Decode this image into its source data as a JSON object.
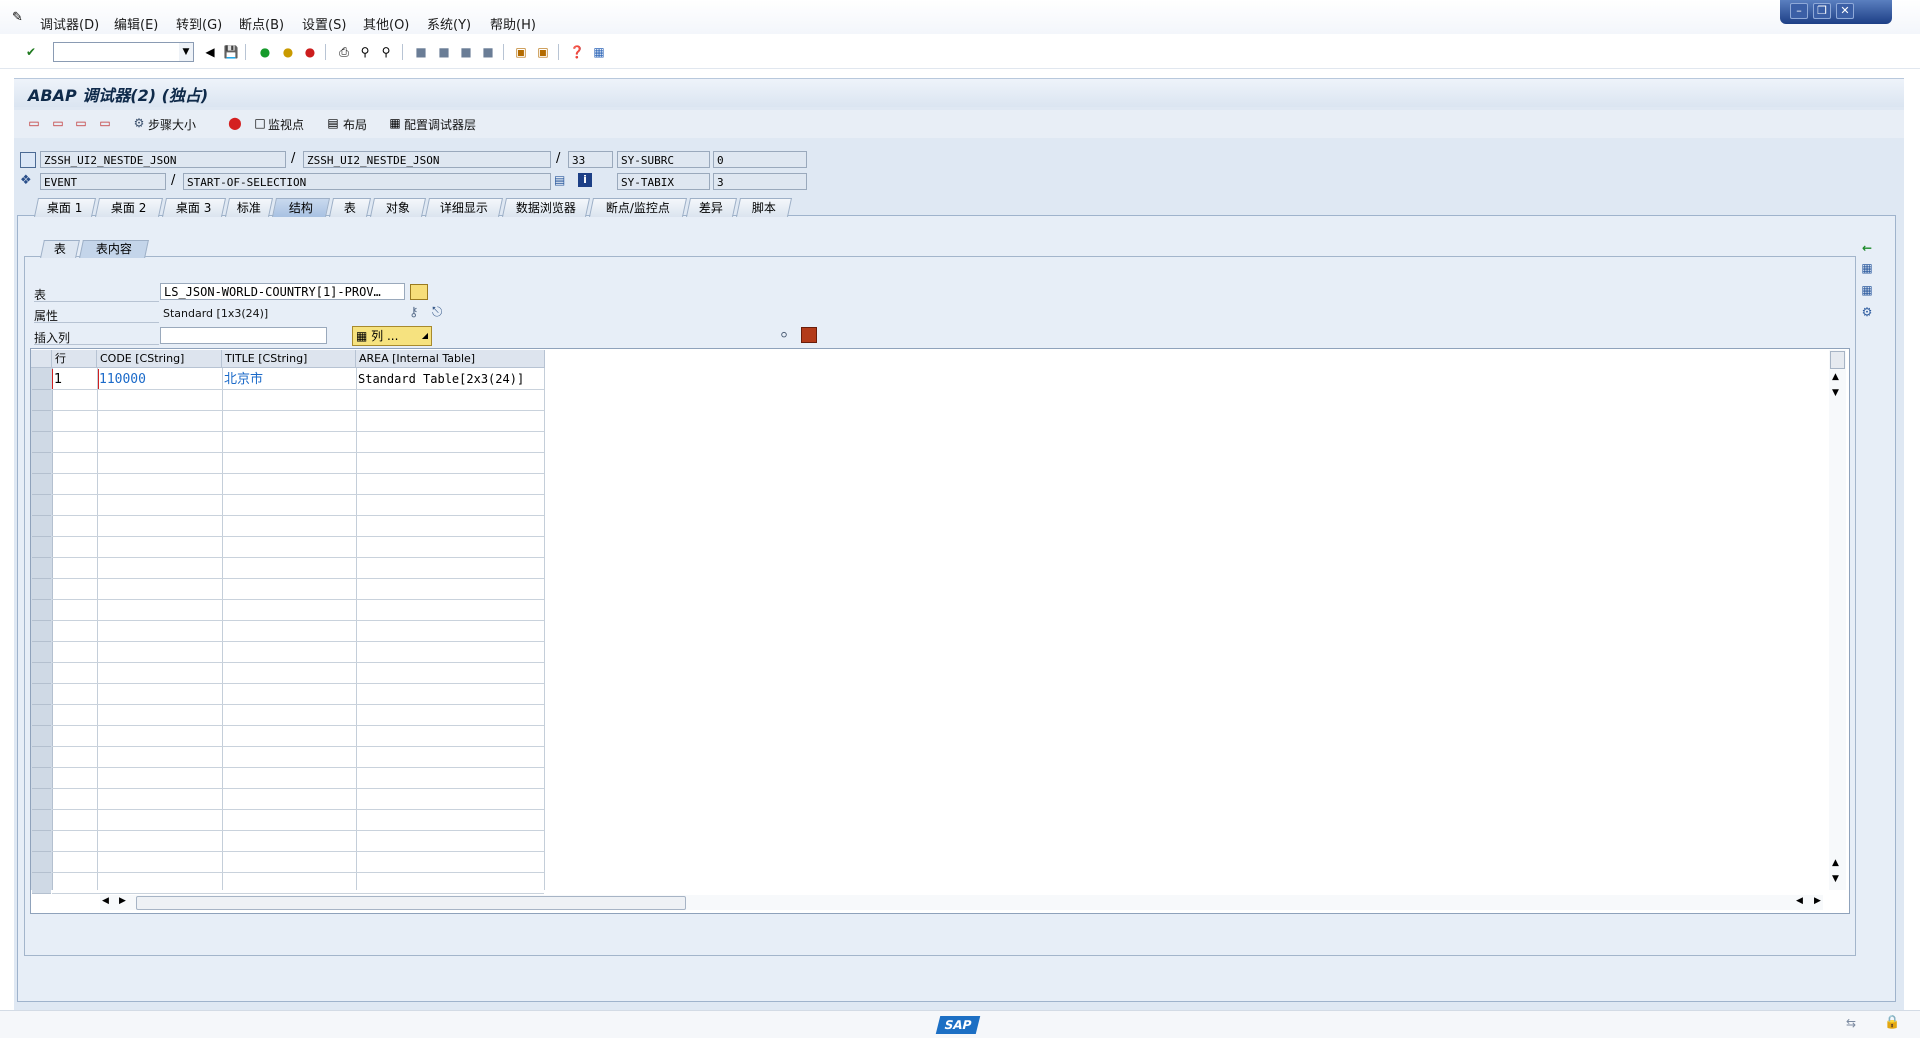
{
  "menu": [
    "调试器(D)",
    "编辑(E)",
    "转到(G)",
    "断点(B)",
    "设置(S)",
    "其他(O)",
    "系统(Y)",
    "帮助(H)"
  ],
  "title": "ABAP 调试器(2) (独占)",
  "app_toolbar": {
    "step_size": "步骤大小",
    "watchpoint": "监视点",
    "layout": "布局",
    "config_layer": "配置调试器层"
  },
  "info": {
    "program1": "ZSSH_UI2_NESTDE_JSON",
    "program2": "ZSSH_UI2_NESTDE_JSON",
    "line": "33",
    "event_type": "EVENT",
    "event_name": "START-OF-SELECTION",
    "sy1_name": "SY-SUBRC",
    "sy1_value": "0",
    "sy2_name": "SY-TABIX",
    "sy2_value": "3",
    "slash": "/"
  },
  "tabs": [
    "桌面 1",
    "桌面 2",
    "桌面 3",
    "标准",
    "结构",
    "表",
    "对象",
    "详细显示",
    "数据浏览器",
    "断点/监控点",
    "差异",
    "脚本"
  ],
  "subtabs": [
    "表",
    "表内容"
  ],
  "table_panel": {
    "table_label": "表",
    "table_value": "LS_JSON-WORLD-COUNTRY[1]-PROV…",
    "attr_label": "属性",
    "attr_value": "Standard [1x3(24)]",
    "insert_label": "插入列",
    "columns_button": "列 ..."
  },
  "grid": {
    "headers": [
      "行",
      "CODE [CString]",
      "TITLE [CString]",
      "AREA [Internal Table]"
    ],
    "rows": [
      {
        "row": "1",
        "code": "110000",
        "title": "北京市",
        "area": "Standard Table[2x3(24)]"
      }
    ]
  },
  "status": {
    "logo": "SAP"
  },
  "colors": {
    "accent": "#1c6fc4",
    "panel": "#dfe8f3",
    "link": "#1b6ac9"
  },
  "icons": [
    "check-icon",
    "back-icon",
    "save-icon",
    "exit-icon",
    "cancel-icon",
    "print-icon",
    "find-icon",
    "help-icon"
  ]
}
